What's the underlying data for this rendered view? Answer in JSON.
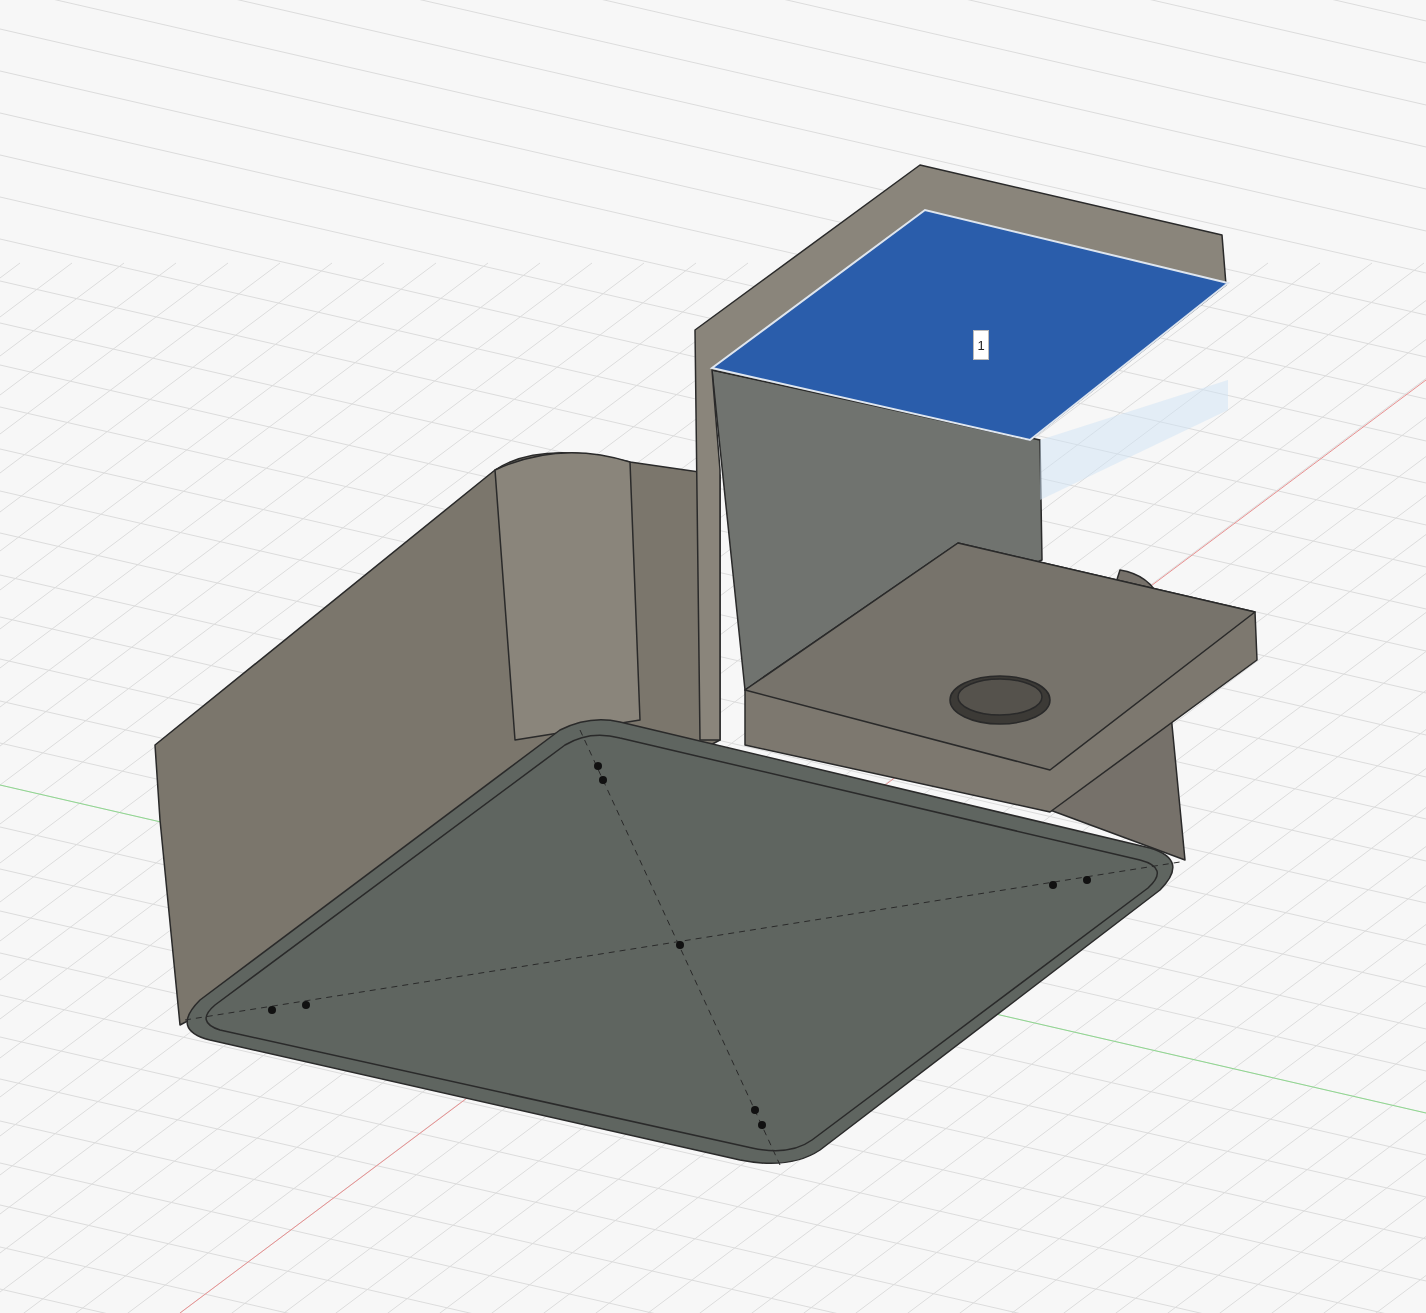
{
  "viewport": {
    "selected_face": {
      "selected": true,
      "face_label": "1"
    }
  }
}
